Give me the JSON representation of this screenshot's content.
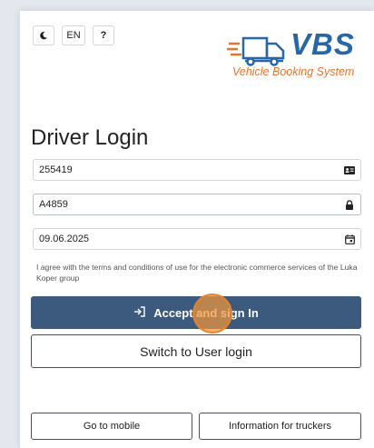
{
  "topbar": {
    "theme_icon": "moon-icon",
    "language": "EN",
    "help": "?"
  },
  "logo": {
    "wordmark": "VBS",
    "subtitle": "Vehicle Booking System",
    "icon": "truck-icon",
    "colors": {
      "primary": "#2766a7",
      "accent": "#e8742c"
    }
  },
  "form": {
    "title": "Driver Login",
    "id_value": "255419",
    "id_icon": "id-card-icon",
    "password_value": "A4859",
    "password_icon": "lock-icon",
    "date_value": "09.06.2025",
    "date_icon": "calendar-icon",
    "terms_text": "I agree with the terms and conditions of use for the electronic commerce services of the Luka Koper group",
    "submit_label": "Accept and sign In",
    "submit_icon": "sign-in-icon",
    "switch_label": "Switch to User login"
  },
  "footer": {
    "mobile_label": "Go to mobile",
    "info_label": "Information for truckers"
  },
  "colors": {
    "primary_button": "#3b5a7e",
    "click_marker": "#f0963c"
  }
}
